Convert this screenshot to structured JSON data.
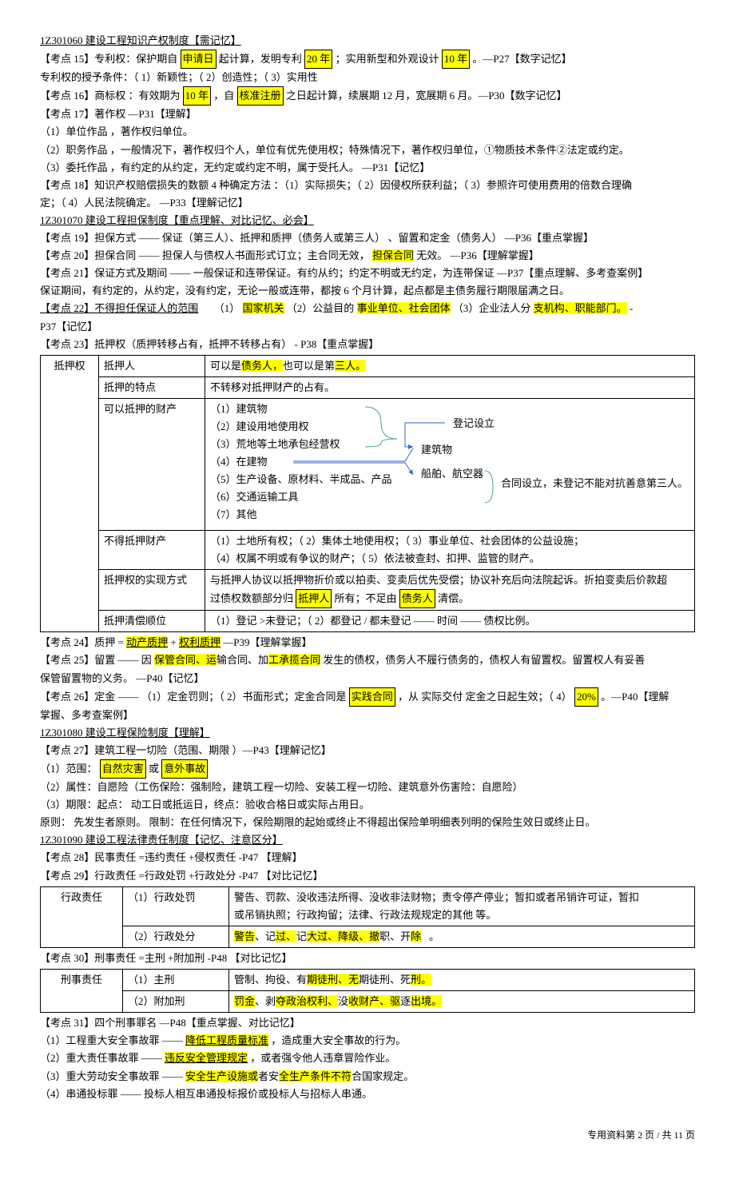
{
  "s1": {
    "title": "1Z301060 建设工程知识产权制度【需记忆】"
  },
  "p15": {
    "pre": "【考点 15】专利权：保护期自",
    "h1": "申请日",
    "mid1": "起计算，发明专利",
    "h2": "20 年",
    "mid2": "；实用新型和外观设计",
    "h3": "10 年",
    "post": "。—P27【数字记忆】",
    "cond": "专利权的授予条件：（ 1）新颖性；（ 2）创造性；（ 3）实用性"
  },
  "p16": {
    "pre": "【考点 16】商标权 ：有效期为",
    "h1": "10 年",
    "mid1": "，自",
    "h2": "核准注册",
    "post": "之日起计算，续展期   12 月，宽展期   6 月。—P30【数字记忆】"
  },
  "p17": {
    "t": "【考点 17】著作权  —P31【理解】",
    "l1": "（1）单位作品 ，著作权归单位。",
    "l2": "（2）职务作品 ，一般情况下，著作权归个人，单位有优先使用权；特殊情况下，著作权归单位，①物质技术条件②法定或约定。",
    "l3": "（3）委托作品 ，有约定的从约定，无约定或约定不明，属于受托人。        —P31【记忆】"
  },
  "p18": {
    "t1": "【考点 18】知识产权赔偿损失的数额    4 种确定方法 ：（1）实际损失；（ 2）因侵权所获利益；（   3）参照许可使用费用的倍数合理确",
    "t2": "定；（ 4）人民法院确定。   —P33【理解记忆】"
  },
  "s2": {
    "title": "1Z301070 建设工程担保制度【重点理解、对比记忆、必会】"
  },
  "p19": {
    "t": "【考点 19】担保方式 —— 保证（第三人）、抵押和质押（债务人或第三人） 、留置和定金（债务人）  —P36【重点掌握】"
  },
  "p20": {
    "pre": "【考点 20】担保合同  —— 担保人与债权人书面形式订立；主合同无效，",
    "h1": "担保合同",
    "post": "无效。  —P36【理解掌握】"
  },
  "p21": {
    "t1": "【考点 21】保证方式及期间   ——  一般保证和连带保证。有约从约；约定不明或无约定，为连带保证     —P37【重点理解、多考查案例】",
    "t2": "保证期间，有约定的，从约定，没有约定，无论一般或连带，都按       6 个月计算，起点都是主债务履行期限届满之日。"
  },
  "p22": {
    "pre": "【考点 22】不得担任保证人的范围",
    "mid1": "（1）",
    "h1": "国家机关",
    "mid2": "（2）公益目的",
    "h2": "事业单位、社会团体",
    "mid3": "（3）企业法人分",
    "h3": "支机构、职能部门。",
    "post": "   -",
    "l2": "P37【记忆】"
  },
  "p23": {
    "t": "【考点 23】抵押权（质押转移占有，抵押不转移占有）    - P38【重点掌握】"
  },
  "t23": {
    "r1c1": "",
    "r1c2": "抵押人",
    "r1c3a": "可以是",
    "r1c3h1": "债务人，",
    "r1c3b": "也可以是第",
    "r1c3h2": "三人。",
    "r2c2": "抵押的特点",
    "r2c3": "不转移对抵押财产的占有。",
    "r3c2": "可以抵押的财产",
    "r3l1": "（1）建筑物",
    "r3l2": "（2）建设用地使用权",
    "r3l3": "（3）荒地等土地承包经营权",
    "r3l4": "（4）在建物",
    "r3l5": "（5）生产设备、原材料、半成品、产品",
    "r3l6": "（6）交通运输工具",
    "r3l7": "（7）其他",
    "r3a1": "登记设立",
    "r3a2": "建筑物",
    "r3a3": "船舶、航空器",
    "r3a4": "合同设立，未登记不能对抗善意第三人。",
    "root": "抵押权",
    "r4c2": "不得抵押财产",
    "r4c3": "（1）土地所有权；（  2）集体土地使用权；（  3）事业单位、社会团体的公益设施；\n（4）权属不明或有争议的财产；（   5）依法被查封、扣押、监管的财产。",
    "r5c2": "抵押权的实现方式",
    "r5c3a": "与抵押人协议以抵押物折价或以拍卖、变卖后优先受偿；协议补充后向法院起诉。折拍变卖后价款超",
    "r5c3b": "过债权数额部分归",
    "r5h1": "抵押人",
    "r5c3c": "所有；不足由",
    "r5h2": "债务人",
    "r5c3d": "清偿。",
    "r6c2": "抵押清偿顺位",
    "r6c3": "（1）登记 >未登记；（ 2）都登记 / 都未登记 —— 时间 —— 债权比例。"
  },
  "p24": {
    "pre": "【考点 24】质押  = ",
    "h1": "动产质押",
    "mid": " + ",
    "h2": "权利质押",
    "post": "  —P39【理解掌握】"
  },
  "p25": {
    "pre": "【考点 25】留置 —— 因 ",
    "h1": "保管合同、运",
    "mid1": "输合同、加",
    "h2": "工承揽合同",
    "post": "   发生的债权，债务人不履行债务的，债权人有留置权。留置权人有妥善",
    "l2": "保管留置物的义务。   —P40【记忆】"
  },
  "p26": {
    "pre": "【考点 26】定金 —— （1）定金罚则；（ 2）书面形式；定金合同是",
    "h1": "实践合同",
    "mid": "，从 实际交付 定金之日起生效；（  4）",
    "h2": "20%",
    "post": "。—P40【理解",
    "l2": "掌握、多考查案例】"
  },
  "s3": {
    "title": "1Z301080 建设工程保险制度【理解】"
  },
  "p27": {
    "t": "【考点 27】建筑工程一切险（范围、期限    ）—P43【理解记忆】",
    "l1a": "（1）范围：",
    "h1": "自然灾害",
    "l1b": "或",
    "h2": "意外事故",
    "l2": "（2）属性：自愿险（工伤保险：强制险，建筑工程一切险、安装工程一切险、建筑意外伤害险：自愿险）",
    "l3": "（3）期限：起点：  动工日或抵运日，终点：验收合格日或实际占用日。",
    "l4": "原则：  先发生者原则。   限制：在任何情况下，保险期限的起始或终止不得超出保险单明细表列明的保险生效日或终止日。"
  },
  "s4": {
    "title": "1Z301090 建设工程法律责任制度【记忆、注意区分】"
  },
  "p28": {
    "t": "【考点 28】民事责任  =违约责任 +侵权责任 -P47 【理解】"
  },
  "p29": {
    "t": "【考点 29】行政责任  =行政处罚 +行政处分 -P47 【对比记忆】"
  },
  "t29": {
    "c1": "行政责任",
    "r1": "（1）行政处罚",
    "r1v": "警告、罚款、没收违法所得、没收非法财物；责令停产停业；暂扣或者吊销许可证，暂扣\n或吊销执照；行政拘留；法律、行政法规规定的其他        等。",
    "r2": "（2）行政处分",
    "r2h1": "警告",
    "r2m1": "、记",
    "r2h2": "过、",
    "r2m2": "记",
    "r2h3": "大过、降",
    "r2h4": "级、撤",
    "r2m3": "职、开",
    "r2h5": "除",
    "r2m4": "。"
  },
  "p30": {
    "t": "【考点 30】刑事责任  =主刑 +附加刑 -P48 【对比记忆】"
  },
  "t30": {
    "c1": "刑事责任",
    "r1": "（1）主刑",
    "r1a": "管制、拘役、有",
    "r1h1": "期徒刑、无",
    "r1m1": "期徒刑、死",
    "r1h2": "刑。",
    "r2": "（2）附加刑",
    "r2h1": "罚金",
    "r2m1": "、剥",
    "r2h2": "夺政治权利、",
    "r2m2": "没",
    "r2h3": "收财产、驱",
    "r2m3": "逐",
    "r2h4": "出境。"
  },
  "p31": {
    "t": "【考点 31】四个刑事罪名  —P48【重点掌握、对比记忆】",
    "l1a": "（1）工程重大安全事故罪   ——",
    "h1": "降低工程质量标准",
    "l1b": "，造成重大安全事故的行为。",
    "l2a": "（2）重大责任事故罪   ——",
    "h2": "违反安全管理规定",
    "l2b": "，或者强令他人违章冒险作业。",
    "l3a": "（3）重大劳动安全事故罪   ——",
    "h3": "安全生产设施或",
    "l3b": "者安",
    "h4": "全生产条件不符",
    "l3c": "合国家规定。",
    "l4": "（4）串通投标罪  —— 投标人相互串通投标报价或投标人与招标人串通。"
  },
  "footer": {
    "t": "专用资料第  2 页 / 共 11 页"
  }
}
